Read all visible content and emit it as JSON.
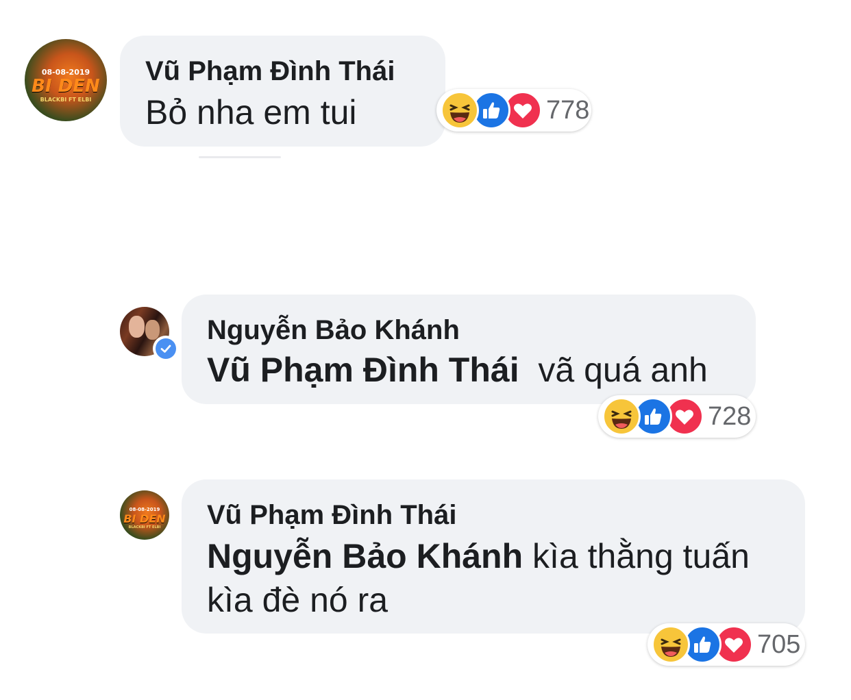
{
  "comments": [
    {
      "author": "Vũ Phạm Đình Thái",
      "text": "Bỏ nha em tui",
      "reaction_count": "778",
      "avatar": {
        "type": "poster",
        "date": "08-08-2019",
        "title": "BI DEN",
        "subtitle": "BLACKBI FT ELBI"
      }
    },
    {
      "author": "Nguyễn Bảo Khánh",
      "mention": "Vũ Phạm Đình Thái",
      "text": "vã quá anh",
      "reaction_count": "728",
      "verified": true,
      "avatar": {
        "type": "photo"
      }
    },
    {
      "author": "Vũ Phạm Đình Thái",
      "mention": "Nguyễn Bảo Khánh",
      "text": "kìa thằng tuấn",
      "text_line2": "kìa đè nó ra",
      "reaction_count": "705",
      "avatar": {
        "type": "poster",
        "date": "08-08-2019",
        "title": "BI DEN",
        "subtitle": "BLACKBI FT ELBI"
      }
    }
  ],
  "reaction_icons": [
    "haha-icon",
    "like-icon",
    "love-icon"
  ],
  "colors": {
    "bubble": "#f0f2f5",
    "haha": "#f7c53a",
    "like": "#1b74e4",
    "love": "#f0314f",
    "verified": "#4a90f2",
    "count_text": "#65676b"
  }
}
